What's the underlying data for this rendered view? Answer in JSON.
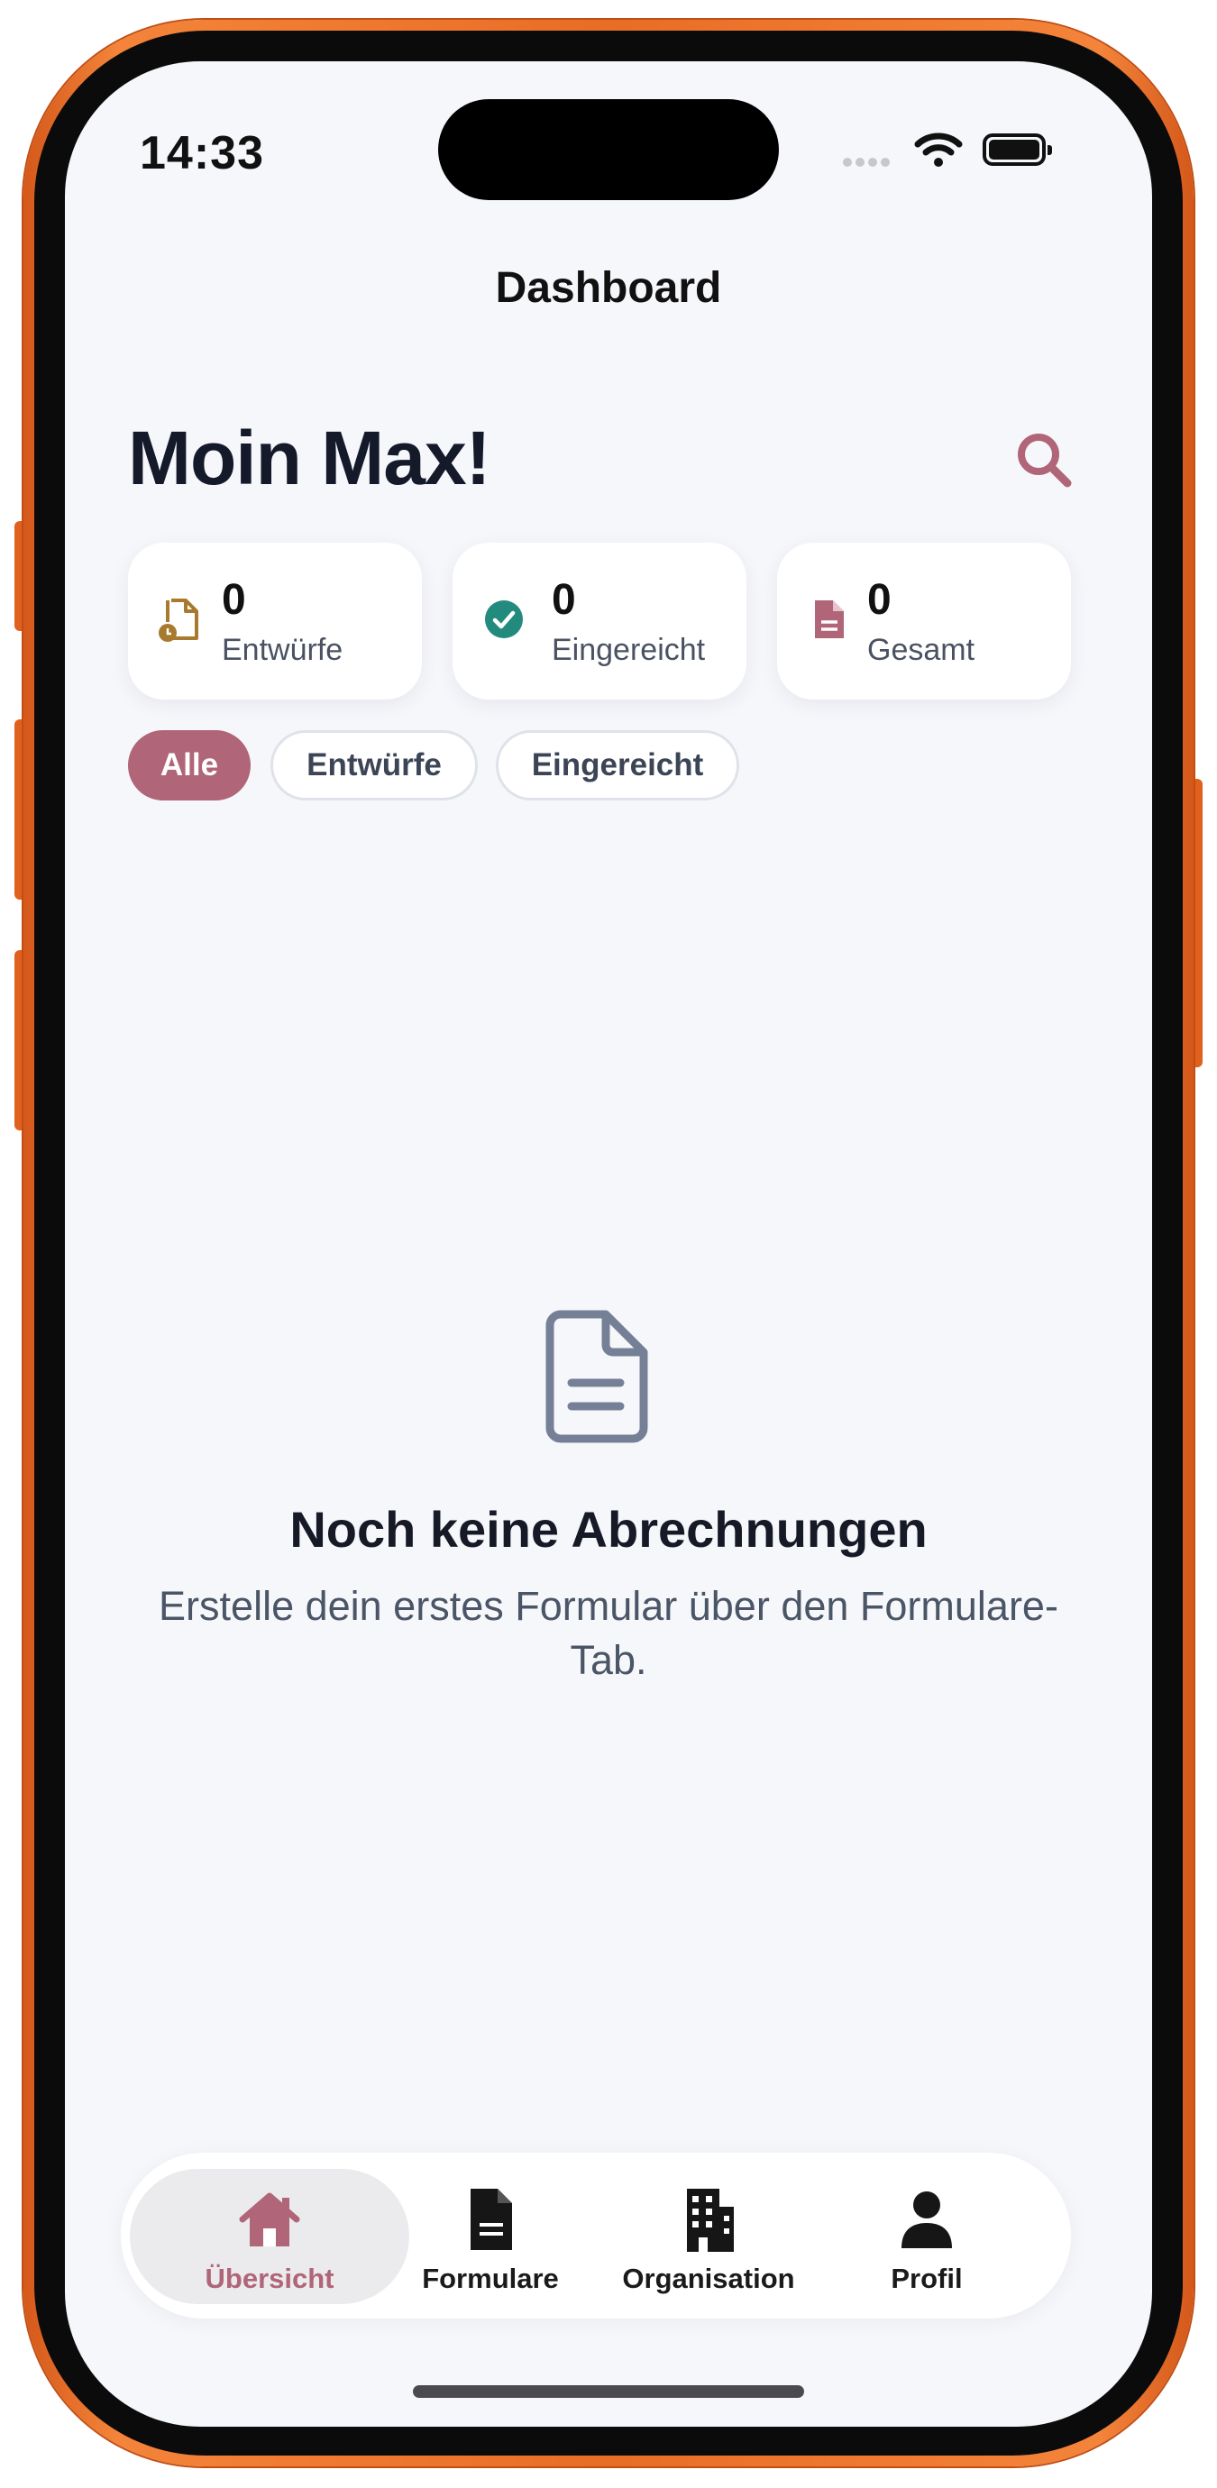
{
  "status_bar": {
    "time": "14:33"
  },
  "header": {
    "title": "Dashboard",
    "greeting": "Moin Max!"
  },
  "stats": [
    {
      "count": "0",
      "label": "Entwürfe",
      "icon": "draft-clock-icon",
      "color": "#a77a2e"
    },
    {
      "count": "0",
      "label": "Eingereicht",
      "icon": "check-circle-icon",
      "color": "#238a7e"
    },
    {
      "count": "0",
      "label": "Gesamt",
      "icon": "document-icon",
      "color": "#b06578"
    }
  ],
  "filters": [
    {
      "label": "Alle",
      "active": true
    },
    {
      "label": "Entwürfe",
      "active": false
    },
    {
      "label": "Eingereicht",
      "active": false
    }
  ],
  "empty_state": {
    "icon": "document-icon",
    "title": "Noch keine Abrechnungen",
    "text": "Erstelle dein erstes Formular über den Formulare-Tab."
  },
  "tabbar": [
    {
      "label": "Übersicht",
      "icon": "home-icon",
      "active": true
    },
    {
      "label": "Formulare",
      "icon": "file-icon",
      "active": false
    },
    {
      "label": "Organisation",
      "icon": "building-icon",
      "active": false
    },
    {
      "label": "Profil",
      "icon": "person-icon",
      "active": false
    }
  ],
  "colors": {
    "accent": "#b06578",
    "background": "#f6f7fb",
    "frame": "#e86d27"
  }
}
